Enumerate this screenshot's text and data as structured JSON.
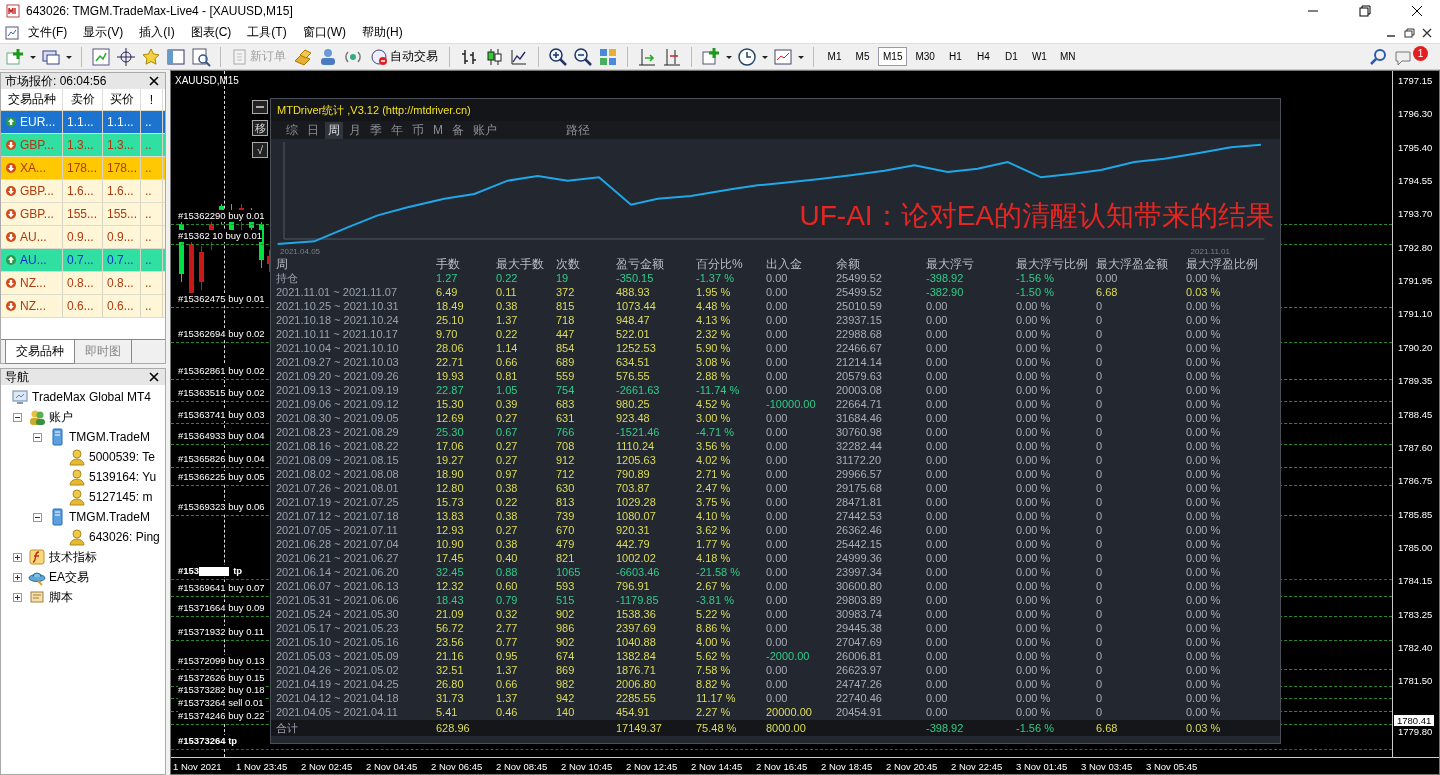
{
  "window": {
    "title": "643026: TMGM.TradeMax-Live4 - [XAUUSD,M15]"
  },
  "menu": [
    "文件(F)",
    "显示(V)",
    "插入(I)",
    "图表(C)",
    "工具(T)",
    "窗口(W)",
    "帮助(H)"
  ],
  "toolbar": {
    "buttons": [
      {
        "label": "新订单",
        "disabled": true
      },
      {
        "label": "自动交易",
        "disabled": false
      }
    ],
    "timeframes": [
      {
        "label": "M1",
        "selected": false
      },
      {
        "label": "M5",
        "selected": false
      },
      {
        "label": "M15",
        "selected": true
      },
      {
        "label": "M30",
        "selected": false
      },
      {
        "label": "H1",
        "selected": false
      },
      {
        "label": "H4",
        "selected": false
      },
      {
        "label": "D1",
        "selected": false
      },
      {
        "label": "W1",
        "selected": false
      },
      {
        "label": "MN",
        "selected": false
      }
    ],
    "notification_badge": "1"
  },
  "market_watch": {
    "title": "市场报价: 06:04:56",
    "columns": [
      "交易品种",
      "卖价",
      "买价",
      "!"
    ],
    "rows": [
      {
        "symbol": "EUR...",
        "bid": "1.1...",
        "ask": "1.1...",
        "flag": "..",
        "rising": true,
        "selected": true,
        "color": "#1c74d0"
      },
      {
        "symbol": "GBP...",
        "bid": "1.3...",
        "ask": "1.3...",
        "flag": "..",
        "rising": false,
        "selected": false,
        "color": "#2fe0a2"
      },
      {
        "symbol": "XA...",
        "bid": "178...",
        "ask": "178...",
        "flag": "..",
        "rising": false,
        "selected": false,
        "color": "#ffc800"
      },
      {
        "symbol": "GBP...",
        "bid": "1.6...",
        "ask": "1.6...",
        "flag": "..",
        "rising": false,
        "selected": false,
        "color": "#fff6d8"
      },
      {
        "symbol": "GBP...",
        "bid": "155...",
        "ask": "155...",
        "flag": "..",
        "rising": false,
        "selected": false,
        "color": "#fff6d8"
      },
      {
        "symbol": "AU...",
        "bid": "0.9...",
        "ask": "0.9...",
        "flag": "..",
        "rising": false,
        "selected": false,
        "color": "#fff6d8"
      },
      {
        "symbol": "AU...",
        "bid": "0.7...",
        "ask": "0.7...",
        "flag": "..",
        "rising": true,
        "selected": false,
        "color": "#2fe0a2"
      },
      {
        "symbol": "NZ...",
        "bid": "0.8...",
        "ask": "0.8...",
        "flag": "..",
        "rising": false,
        "selected": false,
        "color": "#fff6d8"
      },
      {
        "symbol": "NZ...",
        "bid": "0.6...",
        "ask": "0.6...",
        "flag": "..",
        "rising": false,
        "selected": false,
        "color": "#fff6d8"
      }
    ],
    "tabs": [
      {
        "label": "交易品种",
        "selected": true
      },
      {
        "label": "即时图",
        "selected": false
      }
    ]
  },
  "navigator": {
    "title": "导航",
    "tree": [
      {
        "label": "TradeMax Global MT4",
        "kind": "terminal",
        "children": [
          {
            "label": "账户",
            "kind": "accounts",
            "expanded": true,
            "children": [
              {
                "label": "TMGM.TradeM",
                "kind": "server",
                "expanded": true,
                "children": [
                  {
                    "label": "5000539: Te",
                    "kind": "account"
                  },
                  {
                    "label": "5139164: Yu",
                    "kind": "account"
                  },
                  {
                    "label": "5127145: m",
                    "kind": "account"
                  }
                ]
              },
              {
                "label": "TMGM.TradeM",
                "kind": "server",
                "expanded": true,
                "children": [
                  {
                    "label": "643026: Ping",
                    "kind": "account"
                  }
                ]
              }
            ]
          },
          {
            "label": "技术指标",
            "kind": "indicators",
            "expanded": false
          },
          {
            "label": "EA交易",
            "kind": "experts",
            "expanded": false
          },
          {
            "label": "脚本",
            "kind": "scripts",
            "expanded": false
          }
        ]
      }
    ]
  },
  "chart": {
    "symbol_label": "XAUUSD,M15",
    "orders": [
      {
        "label": "#15362290 buy 0.01",
        "kind": "order",
        "redacted": false
      },
      {
        "label": "#15362 10 buy 0.01",
        "kind": "order",
        "redacted": false
      },
      {
        "label": "#15362475 buy 0.01",
        "kind": "order",
        "redacted": false
      },
      {
        "label": "#15362694 buy 0.02",
        "kind": "order",
        "redacted": false
      },
      {
        "label": "#15362861 buy 0.02",
        "kind": "order",
        "redacted": false
      },
      {
        "label": "#15363515 buy 0.02",
        "kind": "order",
        "redacted": false
      },
      {
        "label": "#15363741 buy 0.03",
        "kind": "order",
        "redacted": false
      },
      {
        "label": "#15364933 buy 0.04",
        "kind": "order",
        "redacted": false
      },
      {
        "label": "#15365826 buy 0.04",
        "kind": "order",
        "redacted": false
      },
      {
        "label": "#15366225 buy 0.05",
        "kind": "order",
        "redacted": false
      },
      {
        "label": "#15369323 buy 0.06",
        "kind": "order",
        "redacted": false
      },
      {
        "label": "#153",
        "suffix": "tp",
        "kind": "tp",
        "redacted": true
      },
      {
        "label": "#15369641 buy 0.07",
        "kind": "order",
        "redacted": false
      },
      {
        "label": "#15371664 buy 0.09",
        "kind": "order",
        "redacted": false
      },
      {
        "label": "#15371932 buy 0.11",
        "kind": "order",
        "redacted": false
      },
      {
        "label": "#15372099 buy 0.13",
        "kind": "order",
        "redacted": false
      },
      {
        "label": "#15372626 buy 0.15",
        "kind": "order",
        "redacted": false
      },
      {
        "label": "#15373282 buy 0.18",
        "kind": "order",
        "redacted": false
      },
      {
        "label": "#15373264 sell 0.01",
        "kind": "order",
        "redacted": false
      },
      {
        "label": "#15374246 buy 0.22",
        "kind": "order",
        "redacted": false
      },
      {
        "label": "#15373264 tp",
        "kind": "tp",
        "redacted": false
      }
    ],
    "price_axis": [
      "1797.15",
      "1796.30",
      "1795.40",
      "1794.55",
      "1793.70",
      "1792.80",
      "1791.95",
      "1791.10",
      "1790.20",
      "1789.35",
      "1788.45",
      "1787.60",
      "1786.75",
      "1785.85",
      "1785.00",
      "1784.15",
      "1783.25",
      "1782.40",
      "1781.50",
      "1779.80"
    ],
    "current_price": "1780.41",
    "time_axis": [
      "1 Nov 2021",
      "1 Nov 23:45",
      "2 Nov 02:45",
      "2 Nov 04:45",
      "2 Nov 06:45",
      "2 Nov 08:45",
      "2 Nov 10:45",
      "2 Nov 12:45",
      "2 Nov 14:45",
      "2 Nov 16:45",
      "2 Nov 18:45",
      "2 Nov 20:45",
      "2 Nov 22:45",
      "3 Nov 01:45",
      "3 Nov 03:45",
      "3 Nov 05:45"
    ]
  },
  "stats_panel": {
    "title": "MTDriver统计 ,V3.12 (http://mtdriver.cn)",
    "side_buttons": [
      "移",
      "√"
    ],
    "tabs": [
      {
        "label": "综",
        "selected": false
      },
      {
        "label": "日",
        "selected": false
      },
      {
        "label": "周",
        "selected": true
      },
      {
        "label": "月",
        "selected": false
      },
      {
        "label": "季",
        "selected": false
      },
      {
        "label": "年",
        "selected": false
      },
      {
        "label": "币",
        "selected": false
      },
      {
        "label": "M",
        "selected": false
      },
      {
        "label": "备",
        "selected": false
      },
      {
        "label": "账户",
        "selected": false
      },
      {
        "label": "路径",
        "selected": false
      }
    ],
    "curve": {
      "start_label": "2021.04.05",
      "end_label": "2021.11.01"
    },
    "caption": "UF-AI：论对EA的清醒认知带来的结果",
    "columns": [
      "周",
      "手数",
      "最大手数",
      "次数",
      "盈亏金额",
      "百分比%",
      "出入金",
      "余额",
      "最大浮亏",
      "最大浮亏比例",
      "最大浮盈金额",
      "最大浮盈比例"
    ],
    "rows": [
      {
        "kind": "holding",
        "loss": true,
        "flow_loss": false,
        "flow_gain": false,
        "float_loss_marked": true,
        "float_gain_marked": false,
        "values": [
          "持仓",
          "1.27",
          "0.22",
          "19",
          "-350.15",
          "-1.37 %",
          "0.00",
          "25499.52",
          "-398.92",
          "-1.56 %",
          "0.00",
          "0.00 %"
        ]
      },
      {
        "kind": "week",
        "loss": false,
        "flow_loss": false,
        "flow_gain": false,
        "float_loss_marked": true,
        "float_gain_marked": true,
        "values": [
          "2021.11.01 ~ 2021.11.07",
          "6.49",
          "0.11",
          "372",
          "488.93",
          "1.95 %",
          "0.00",
          "25499.52",
          "-382.90",
          "-1.50 %",
          "6.68",
          "0.03 %"
        ]
      },
      {
        "kind": "week",
        "loss": false,
        "flow_loss": false,
        "flow_gain": false,
        "float_loss_marked": false,
        "float_gain_marked": false,
        "values": [
          "2021.10.25 ~ 2021.10.31",
          "18.49",
          "0.38",
          "815",
          "1073.44",
          "4.48 %",
          "0.00",
          "25010.59",
          "0.00",
          "0.00 %",
          "0",
          "0.00 %"
        ]
      },
      {
        "kind": "week",
        "loss": false,
        "flow_loss": false,
        "flow_gain": false,
        "float_loss_marked": false,
        "float_gain_marked": false,
        "values": [
          "2021.10.18 ~ 2021.10.24",
          "25.10",
          "1.37",
          "718",
          "948.47",
          "4.13 %",
          "0.00",
          "23937.15",
          "0.00",
          "0.00 %",
          "0",
          "0.00 %"
        ]
      },
      {
        "kind": "week",
        "loss": false,
        "flow_loss": false,
        "flow_gain": false,
        "float_loss_marked": false,
        "float_gain_marked": false,
        "values": [
          "2021.10.11 ~ 2021.10.17",
          "9.70",
          "0.22",
          "447",
          "522.01",
          "2.32 %",
          "0.00",
          "22988.68",
          "0.00",
          "0.00 %",
          "0",
          "0.00 %"
        ]
      },
      {
        "kind": "week",
        "loss": false,
        "flow_loss": false,
        "flow_gain": false,
        "float_loss_marked": false,
        "float_gain_marked": false,
        "values": [
          "2021.10.04 ~ 2021.10.10",
          "28.06",
          "1.14",
          "854",
          "1252.53",
          "5.90 %",
          "0.00",
          "22466.67",
          "0.00",
          "0.00 %",
          "0",
          "0.00 %"
        ]
      },
      {
        "kind": "week",
        "loss": false,
        "flow_loss": false,
        "flow_gain": false,
        "float_loss_marked": false,
        "float_gain_marked": false,
        "values": [
          "2021.09.27 ~ 2021.10.03",
          "22.71",
          "0.66",
          "689",
          "634.51",
          "3.08 %",
          "0.00",
          "21214.14",
          "0.00",
          "0.00 %",
          "0",
          "0.00 %"
        ]
      },
      {
        "kind": "week",
        "loss": false,
        "flow_loss": false,
        "flow_gain": false,
        "float_loss_marked": false,
        "float_gain_marked": false,
        "values": [
          "2021.09.20 ~ 2021.09.26",
          "19.93",
          "0.81",
          "559",
          "576.55",
          "2.88 %",
          "0.00",
          "20579.63",
          "0.00",
          "0.00 %",
          "0",
          "0.00 %"
        ]
      },
      {
        "kind": "week",
        "loss": true,
        "flow_loss": false,
        "flow_gain": false,
        "float_loss_marked": false,
        "float_gain_marked": false,
        "values": [
          "2021.09.13 ~ 2021.09.19",
          "22.87",
          "1.05",
          "754",
          "-2661.63",
          "-11.74 %",
          "0.00",
          "20003.08",
          "0.00",
          "0.00 %",
          "0",
          "0.00 %"
        ]
      },
      {
        "kind": "week",
        "loss": false,
        "flow_loss": true,
        "flow_gain": false,
        "float_loss_marked": false,
        "float_gain_marked": false,
        "values": [
          "2021.09.06 ~ 2021.09.12",
          "15.30",
          "0.39",
          "683",
          "980.25",
          "4.52 %",
          "-10000.00",
          "22664.71",
          "0.00",
          "0.00 %",
          "0",
          "0.00 %"
        ]
      },
      {
        "kind": "week",
        "loss": false,
        "flow_loss": false,
        "flow_gain": false,
        "float_loss_marked": false,
        "float_gain_marked": false,
        "values": [
          "2021.08.30 ~ 2021.09.05",
          "12.69",
          "0.27",
          "631",
          "923.48",
          "3.00 %",
          "0.00",
          "31684.46",
          "0.00",
          "0.00 %",
          "0",
          "0.00 %"
        ]
      },
      {
        "kind": "week",
        "loss": true,
        "flow_loss": false,
        "flow_gain": false,
        "float_loss_marked": false,
        "float_gain_marked": false,
        "values": [
          "2021.08.23 ~ 2021.08.29",
          "25.30",
          "0.67",
          "766",
          "-1521.46",
          "-4.71 %",
          "0.00",
          "30760.98",
          "0.00",
          "0.00 %",
          "0",
          "0.00 %"
        ]
      },
      {
        "kind": "week",
        "loss": false,
        "flow_loss": false,
        "flow_gain": false,
        "float_loss_marked": false,
        "float_gain_marked": false,
        "values": [
          "2021.08.16 ~ 2021.08.22",
          "17.06",
          "0.27",
          "708",
          "1110.24",
          "3.56 %",
          "0.00",
          "32282.44",
          "0.00",
          "0.00 %",
          "0",
          "0.00 %"
        ]
      },
      {
        "kind": "week",
        "loss": false,
        "flow_loss": false,
        "flow_gain": false,
        "float_loss_marked": false,
        "float_gain_marked": false,
        "values": [
          "2021.08.09 ~ 2021.08.15",
          "19.27",
          "0.27",
          "912",
          "1205.63",
          "4.02 %",
          "0.00",
          "31172.20",
          "0.00",
          "0.00 %",
          "0",
          "0.00 %"
        ]
      },
      {
        "kind": "week",
        "loss": false,
        "flow_loss": false,
        "flow_gain": false,
        "float_loss_marked": false,
        "float_gain_marked": false,
        "values": [
          "2021.08.02 ~ 2021.08.08",
          "18.90",
          "0.97",
          "712",
          "790.89",
          "2.71 %",
          "0.00",
          "29966.57",
          "0.00",
          "0.00 %",
          "0",
          "0.00 %"
        ]
      },
      {
        "kind": "week",
        "loss": false,
        "flow_loss": false,
        "flow_gain": false,
        "float_loss_marked": false,
        "float_gain_marked": false,
        "values": [
          "2021.07.26 ~ 2021.08.01",
          "12.80",
          "0.38",
          "630",
          "703.87",
          "2.47 %",
          "0.00",
          "29175.68",
          "0.00",
          "0.00 %",
          "0",
          "0.00 %"
        ]
      },
      {
        "kind": "week",
        "loss": false,
        "flow_loss": false,
        "flow_gain": false,
        "float_loss_marked": false,
        "float_gain_marked": false,
        "values": [
          "2021.07.19 ~ 2021.07.25",
          "15.73",
          "0.22",
          "813",
          "1029.28",
          "3.75 %",
          "0.00",
          "28471.81",
          "0.00",
          "0.00 %",
          "0",
          "0.00 %"
        ]
      },
      {
        "kind": "week",
        "loss": false,
        "flow_loss": false,
        "flow_gain": false,
        "float_loss_marked": false,
        "float_gain_marked": false,
        "values": [
          "2021.07.12 ~ 2021.07.18",
          "13.83",
          "0.38",
          "739",
          "1080.07",
          "4.10 %",
          "0.00",
          "27442.53",
          "0.00",
          "0.00 %",
          "0",
          "0.00 %"
        ]
      },
      {
        "kind": "week",
        "loss": false,
        "flow_loss": false,
        "flow_gain": false,
        "float_loss_marked": false,
        "float_gain_marked": false,
        "values": [
          "2021.07.05 ~ 2021.07.11",
          "12.93",
          "0.27",
          "670",
          "920.31",
          "3.62 %",
          "0.00",
          "26362.46",
          "0.00",
          "0.00 %",
          "0",
          "0.00 %"
        ]
      },
      {
        "kind": "week",
        "loss": false,
        "flow_loss": false,
        "flow_gain": false,
        "float_loss_marked": false,
        "float_gain_marked": false,
        "values": [
          "2021.06.28 ~ 2021.07.04",
          "10.90",
          "0.38",
          "479",
          "442.79",
          "1.77 %",
          "0.00",
          "25442.15",
          "0.00",
          "0.00 %",
          "0",
          "0.00 %"
        ]
      },
      {
        "kind": "week",
        "loss": false,
        "flow_loss": false,
        "flow_gain": false,
        "float_loss_marked": false,
        "float_gain_marked": false,
        "values": [
          "2021.06.21 ~ 2021.06.27",
          "17.45",
          "0.40",
          "821",
          "1002.02",
          "4.18 %",
          "0.00",
          "24999.36",
          "0.00",
          "0.00 %",
          "0",
          "0.00 %"
        ]
      },
      {
        "kind": "week",
        "loss": true,
        "flow_loss": false,
        "flow_gain": false,
        "float_loss_marked": false,
        "float_gain_marked": false,
        "values": [
          "2021.06.14 ~ 2021.06.20",
          "32.45",
          "0.88",
          "1065",
          "-6603.46",
          "-21.58 %",
          "0.00",
          "23997.34",
          "0.00",
          "0.00 %",
          "0",
          "0.00 %"
        ]
      },
      {
        "kind": "week",
        "loss": false,
        "flow_loss": false,
        "flow_gain": false,
        "float_loss_marked": false,
        "float_gain_marked": false,
        "values": [
          "2021.06.07 ~ 2021.06.13",
          "12.32",
          "0.60",
          "593",
          "796.91",
          "2.67 %",
          "0.00",
          "30600.80",
          "0.00",
          "0.00 %",
          "0",
          "0.00 %"
        ]
      },
      {
        "kind": "week",
        "loss": true,
        "flow_loss": false,
        "flow_gain": false,
        "float_loss_marked": false,
        "float_gain_marked": false,
        "values": [
          "2021.05.31 ~ 2021.06.06",
          "18.43",
          "0.79",
          "515",
          "-1179.85",
          "-3.81 %",
          "0.00",
          "29803.89",
          "0.00",
          "0.00 %",
          "0",
          "0.00 %"
        ]
      },
      {
        "kind": "week",
        "loss": false,
        "flow_loss": false,
        "flow_gain": false,
        "float_loss_marked": false,
        "float_gain_marked": false,
        "values": [
          "2021.05.24 ~ 2021.05.30",
          "21.09",
          "0.32",
          "902",
          "1538.36",
          "5.22 %",
          "0.00",
          "30983.74",
          "0.00",
          "0.00 %",
          "0",
          "0.00 %"
        ]
      },
      {
        "kind": "week",
        "loss": false,
        "flow_loss": false,
        "flow_gain": false,
        "float_loss_marked": false,
        "float_gain_marked": false,
        "values": [
          "2021.05.17 ~ 2021.05.23",
          "56.72",
          "2.77",
          "986",
          "2397.69",
          "8.86 %",
          "0.00",
          "29445.38",
          "0.00",
          "0.00 %",
          "0",
          "0.00 %"
        ]
      },
      {
        "kind": "week",
        "loss": false,
        "flow_loss": false,
        "flow_gain": false,
        "float_loss_marked": false,
        "float_gain_marked": false,
        "values": [
          "2021.05.10 ~ 2021.05.16",
          "23.56",
          "0.77",
          "902",
          "1040.88",
          "4.00 %",
          "0.00",
          "27047.69",
          "0.00",
          "0.00 %",
          "0",
          "0.00 %"
        ]
      },
      {
        "kind": "week",
        "loss": false,
        "flow_loss": true,
        "flow_gain": false,
        "float_loss_marked": false,
        "float_gain_marked": false,
        "values": [
          "2021.05.03 ~ 2021.05.09",
          "21.16",
          "0.95",
          "674",
          "1382.84",
          "5.62 %",
          "-2000.00",
          "26006.81",
          "0.00",
          "0.00 %",
          "0",
          "0.00 %"
        ]
      },
      {
        "kind": "week",
        "loss": false,
        "flow_loss": false,
        "flow_gain": false,
        "float_loss_marked": false,
        "float_gain_marked": false,
        "values": [
          "2021.04.26 ~ 2021.05.02",
          "32.51",
          "1.37",
          "869",
          "1876.71",
          "7.58 %",
          "0.00",
          "26623.97",
          "0.00",
          "0.00 %",
          "0",
          "0.00 %"
        ]
      },
      {
        "kind": "week",
        "loss": false,
        "flow_loss": false,
        "flow_gain": false,
        "float_loss_marked": false,
        "float_gain_marked": false,
        "values": [
          "2021.04.19 ~ 2021.04.25",
          "26.80",
          "0.66",
          "982",
          "2006.80",
          "8.82 %",
          "0.00",
          "24747.26",
          "0.00",
          "0.00 %",
          "0",
          "0.00 %"
        ]
      },
      {
        "kind": "week",
        "loss": false,
        "flow_loss": false,
        "flow_gain": false,
        "float_loss_marked": false,
        "float_gain_marked": false,
        "values": [
          "2021.04.12 ~ 2021.04.18",
          "31.73",
          "1.37",
          "942",
          "2285.55",
          "11.17 %",
          "0.00",
          "22740.46",
          "0.00",
          "0.00 %",
          "0",
          "0.00 %"
        ]
      },
      {
        "kind": "week",
        "loss": false,
        "flow_loss": false,
        "flow_gain": true,
        "float_loss_marked": false,
        "float_gain_marked": false,
        "values": [
          "2021.04.05 ~ 2021.04.11",
          "5.41",
          "0.46",
          "140",
          "454.91",
          "2.27 %",
          "20000.00",
          "20454.91",
          "0.00",
          "0.00 %",
          "0",
          "0.00 %"
        ]
      },
      {
        "kind": "total",
        "loss": false,
        "flow_loss": false,
        "flow_gain": true,
        "float_loss_marked": true,
        "float_gain_marked": true,
        "values": [
          "合计",
          "628.96",
          "17149.37",
          "75.48 %",
          "8000.00",
          "-398.92",
          "-1.56 %",
          "6.68",
          "0.03 %"
        ]
      }
    ]
  }
}
